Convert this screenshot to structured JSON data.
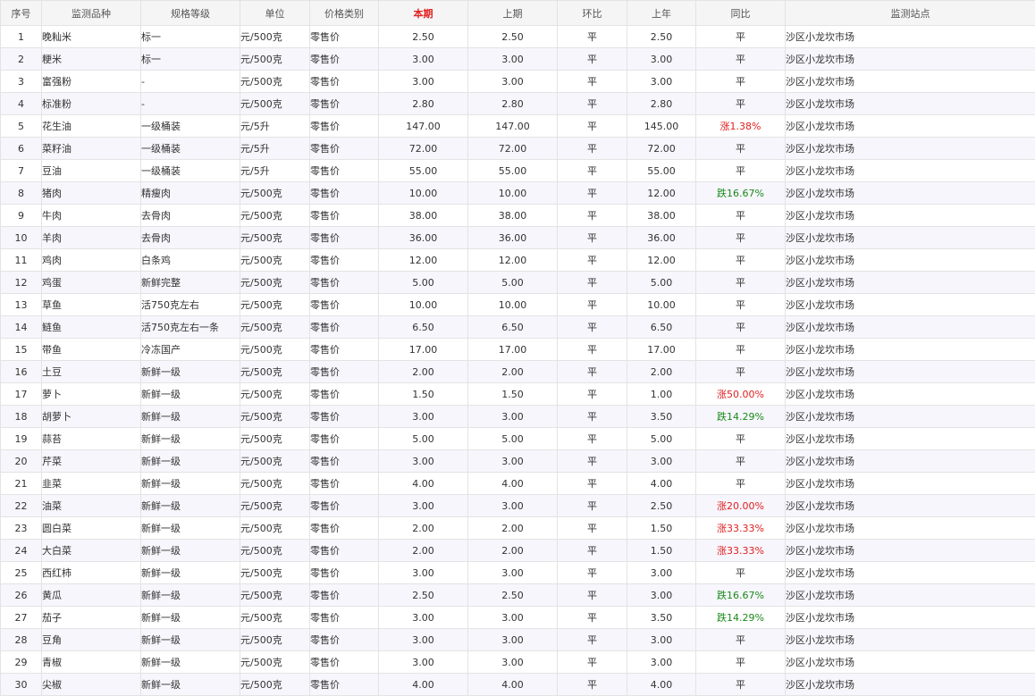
{
  "table": {
    "headers": [
      {
        "key": "seq",
        "label": "序号"
      },
      {
        "key": "variety",
        "label": "监测品种"
      },
      {
        "key": "spec",
        "label": "规格等级"
      },
      {
        "key": "unit",
        "label": "单位"
      },
      {
        "key": "price_type",
        "label": "价格类别"
      },
      {
        "key": "current",
        "label": "本期",
        "highlight": true
      },
      {
        "key": "previous",
        "label": "上期"
      },
      {
        "key": "mom",
        "label": "环比"
      },
      {
        "key": "last_year",
        "label": "上年"
      },
      {
        "key": "yoy",
        "label": "同比"
      },
      {
        "key": "station",
        "label": "监测站点"
      }
    ],
    "colors": {
      "up": "#e02020",
      "down": "#1a8a1a",
      "highlight_header": "#e02020"
    },
    "rows": [
      {
        "seq": "1",
        "variety": "晚籼米",
        "spec": "标一",
        "unit": "元/500克",
        "price_type": "零售价",
        "current": "2.50",
        "previous": "2.50",
        "mom": "平",
        "last_year": "2.50",
        "yoy": "平",
        "yoy_dir": "flat",
        "station": "沙区小龙坎市场"
      },
      {
        "seq": "2",
        "variety": "粳米",
        "spec": "标一",
        "unit": "元/500克",
        "price_type": "零售价",
        "current": "3.00",
        "previous": "3.00",
        "mom": "平",
        "last_year": "3.00",
        "yoy": "平",
        "yoy_dir": "flat",
        "station": "沙区小龙坎市场"
      },
      {
        "seq": "3",
        "variety": "富强粉",
        "spec": "-",
        "unit": "元/500克",
        "price_type": "零售价",
        "current": "3.00",
        "previous": "3.00",
        "mom": "平",
        "last_year": "3.00",
        "yoy": "平",
        "yoy_dir": "flat",
        "station": "沙区小龙坎市场"
      },
      {
        "seq": "4",
        "variety": "标准粉",
        "spec": "-",
        "unit": "元/500克",
        "price_type": "零售价",
        "current": "2.80",
        "previous": "2.80",
        "mom": "平",
        "last_year": "2.80",
        "yoy": "平",
        "yoy_dir": "flat",
        "station": "沙区小龙坎市场"
      },
      {
        "seq": "5",
        "variety": "花生油",
        "spec": "一级桶装",
        "unit": "元/5升",
        "price_type": "零售价",
        "current": "147.00",
        "previous": "147.00",
        "mom": "平",
        "last_year": "145.00",
        "yoy": "涨1.38%",
        "yoy_dir": "up",
        "station": "沙区小龙坎市场"
      },
      {
        "seq": "6",
        "variety": "菜籽油",
        "spec": "一级桶装",
        "unit": "元/5升",
        "price_type": "零售价",
        "current": "72.00",
        "previous": "72.00",
        "mom": "平",
        "last_year": "72.00",
        "yoy": "平",
        "yoy_dir": "flat",
        "station": "沙区小龙坎市场"
      },
      {
        "seq": "7",
        "variety": "豆油",
        "spec": "一级桶装",
        "unit": "元/5升",
        "price_type": "零售价",
        "current": "55.00",
        "previous": "55.00",
        "mom": "平",
        "last_year": "55.00",
        "yoy": "平",
        "yoy_dir": "flat",
        "station": "沙区小龙坎市场"
      },
      {
        "seq": "8",
        "variety": "猪肉",
        "spec": "精瘦肉",
        "unit": "元/500克",
        "price_type": "零售价",
        "current": "10.00",
        "previous": "10.00",
        "mom": "平",
        "last_year": "12.00",
        "yoy": "跌16.67%",
        "yoy_dir": "down",
        "station": "沙区小龙坎市场"
      },
      {
        "seq": "9",
        "variety": "牛肉",
        "spec": "去骨肉",
        "unit": "元/500克",
        "price_type": "零售价",
        "current": "38.00",
        "previous": "38.00",
        "mom": "平",
        "last_year": "38.00",
        "yoy": "平",
        "yoy_dir": "flat",
        "station": "沙区小龙坎市场"
      },
      {
        "seq": "10",
        "variety": "羊肉",
        "spec": "去骨肉",
        "unit": "元/500克",
        "price_type": "零售价",
        "current": "36.00",
        "previous": "36.00",
        "mom": "平",
        "last_year": "36.00",
        "yoy": "平",
        "yoy_dir": "flat",
        "station": "沙区小龙坎市场"
      },
      {
        "seq": "11",
        "variety": "鸡肉",
        "spec": "白条鸡",
        "unit": "元/500克",
        "price_type": "零售价",
        "current": "12.00",
        "previous": "12.00",
        "mom": "平",
        "last_year": "12.00",
        "yoy": "平",
        "yoy_dir": "flat",
        "station": "沙区小龙坎市场"
      },
      {
        "seq": "12",
        "variety": "鸡蛋",
        "spec": "新鲜完整",
        "unit": "元/500克",
        "price_type": "零售价",
        "current": "5.00",
        "previous": "5.00",
        "mom": "平",
        "last_year": "5.00",
        "yoy": "平",
        "yoy_dir": "flat",
        "station": "沙区小龙坎市场"
      },
      {
        "seq": "13",
        "variety": "草鱼",
        "spec": "活750克左右",
        "unit": "元/500克",
        "price_type": "零售价",
        "current": "10.00",
        "previous": "10.00",
        "mom": "平",
        "last_year": "10.00",
        "yoy": "平",
        "yoy_dir": "flat",
        "station": "沙区小龙坎市场"
      },
      {
        "seq": "14",
        "variety": "鲢鱼",
        "spec": "活750克左右一条",
        "unit": "元/500克",
        "price_type": "零售价",
        "current": "6.50",
        "previous": "6.50",
        "mom": "平",
        "last_year": "6.50",
        "yoy": "平",
        "yoy_dir": "flat",
        "station": "沙区小龙坎市场"
      },
      {
        "seq": "15",
        "variety": "带鱼",
        "spec": "冷冻国产",
        "unit": "元/500克",
        "price_type": "零售价",
        "current": "17.00",
        "previous": "17.00",
        "mom": "平",
        "last_year": "17.00",
        "yoy": "平",
        "yoy_dir": "flat",
        "station": "沙区小龙坎市场"
      },
      {
        "seq": "16",
        "variety": "土豆",
        "spec": "新鲜一级",
        "unit": "元/500克",
        "price_type": "零售价",
        "current": "2.00",
        "previous": "2.00",
        "mom": "平",
        "last_year": "2.00",
        "yoy": "平",
        "yoy_dir": "flat",
        "station": "沙区小龙坎市场"
      },
      {
        "seq": "17",
        "variety": "萝卜",
        "spec": "新鲜一级",
        "unit": "元/500克",
        "price_type": "零售价",
        "current": "1.50",
        "previous": "1.50",
        "mom": "平",
        "last_year": "1.00",
        "yoy": "涨50.00%",
        "yoy_dir": "up",
        "station": "沙区小龙坎市场"
      },
      {
        "seq": "18",
        "variety": "胡萝卜",
        "spec": "新鲜一级",
        "unit": "元/500克",
        "price_type": "零售价",
        "current": "3.00",
        "previous": "3.00",
        "mom": "平",
        "last_year": "3.50",
        "yoy": "跌14.29%",
        "yoy_dir": "down",
        "station": "沙区小龙坎市场"
      },
      {
        "seq": "19",
        "variety": "蒜苔",
        "spec": "新鲜一级",
        "unit": "元/500克",
        "price_type": "零售价",
        "current": "5.00",
        "previous": "5.00",
        "mom": "平",
        "last_year": "5.00",
        "yoy": "平",
        "yoy_dir": "flat",
        "station": "沙区小龙坎市场"
      },
      {
        "seq": "20",
        "variety": "芹菜",
        "spec": "新鲜一级",
        "unit": "元/500克",
        "price_type": "零售价",
        "current": "3.00",
        "previous": "3.00",
        "mom": "平",
        "last_year": "3.00",
        "yoy": "平",
        "yoy_dir": "flat",
        "station": "沙区小龙坎市场"
      },
      {
        "seq": "21",
        "variety": "韭菜",
        "spec": "新鲜一级",
        "unit": "元/500克",
        "price_type": "零售价",
        "current": "4.00",
        "previous": "4.00",
        "mom": "平",
        "last_year": "4.00",
        "yoy": "平",
        "yoy_dir": "flat",
        "station": "沙区小龙坎市场"
      },
      {
        "seq": "22",
        "variety": "油菜",
        "spec": "新鲜一级",
        "unit": "元/500克",
        "price_type": "零售价",
        "current": "3.00",
        "previous": "3.00",
        "mom": "平",
        "last_year": "2.50",
        "yoy": "涨20.00%",
        "yoy_dir": "up",
        "station": "沙区小龙坎市场"
      },
      {
        "seq": "23",
        "variety": "圆白菜",
        "spec": "新鲜一级",
        "unit": "元/500克",
        "price_type": "零售价",
        "current": "2.00",
        "previous": "2.00",
        "mom": "平",
        "last_year": "1.50",
        "yoy": "涨33.33%",
        "yoy_dir": "up",
        "station": "沙区小龙坎市场"
      },
      {
        "seq": "24",
        "variety": "大白菜",
        "spec": "新鲜一级",
        "unit": "元/500克",
        "price_type": "零售价",
        "current": "2.00",
        "previous": "2.00",
        "mom": "平",
        "last_year": "1.50",
        "yoy": "涨33.33%",
        "yoy_dir": "up",
        "station": "沙区小龙坎市场"
      },
      {
        "seq": "25",
        "variety": "西红柿",
        "spec": "新鲜一级",
        "unit": "元/500克",
        "price_type": "零售价",
        "current": "3.00",
        "previous": "3.00",
        "mom": "平",
        "last_year": "3.00",
        "yoy": "平",
        "yoy_dir": "flat",
        "station": "沙区小龙坎市场"
      },
      {
        "seq": "26",
        "variety": "黄瓜",
        "spec": "新鲜一级",
        "unit": "元/500克",
        "price_type": "零售价",
        "current": "2.50",
        "previous": "2.50",
        "mom": "平",
        "last_year": "3.00",
        "yoy": "跌16.67%",
        "yoy_dir": "down",
        "station": "沙区小龙坎市场"
      },
      {
        "seq": "27",
        "variety": "茄子",
        "spec": "新鲜一级",
        "unit": "元/500克",
        "price_type": "零售价",
        "current": "3.00",
        "previous": "3.00",
        "mom": "平",
        "last_year": "3.50",
        "yoy": "跌14.29%",
        "yoy_dir": "down",
        "station": "沙区小龙坎市场"
      },
      {
        "seq": "28",
        "variety": "豆角",
        "spec": "新鲜一级",
        "unit": "元/500克",
        "price_type": "零售价",
        "current": "3.00",
        "previous": "3.00",
        "mom": "平",
        "last_year": "3.00",
        "yoy": "平",
        "yoy_dir": "flat",
        "station": "沙区小龙坎市场"
      },
      {
        "seq": "29",
        "variety": "青椒",
        "spec": "新鲜一级",
        "unit": "元/500克",
        "price_type": "零售价",
        "current": "3.00",
        "previous": "3.00",
        "mom": "平",
        "last_year": "3.00",
        "yoy": "平",
        "yoy_dir": "flat",
        "station": "沙区小龙坎市场"
      },
      {
        "seq": "30",
        "variety": "尖椒",
        "spec": "新鲜一级",
        "unit": "元/500克",
        "price_type": "零售价",
        "current": "4.00",
        "previous": "4.00",
        "mom": "平",
        "last_year": "4.00",
        "yoy": "平",
        "yoy_dir": "flat",
        "station": "沙区小龙坎市场"
      }
    ]
  }
}
